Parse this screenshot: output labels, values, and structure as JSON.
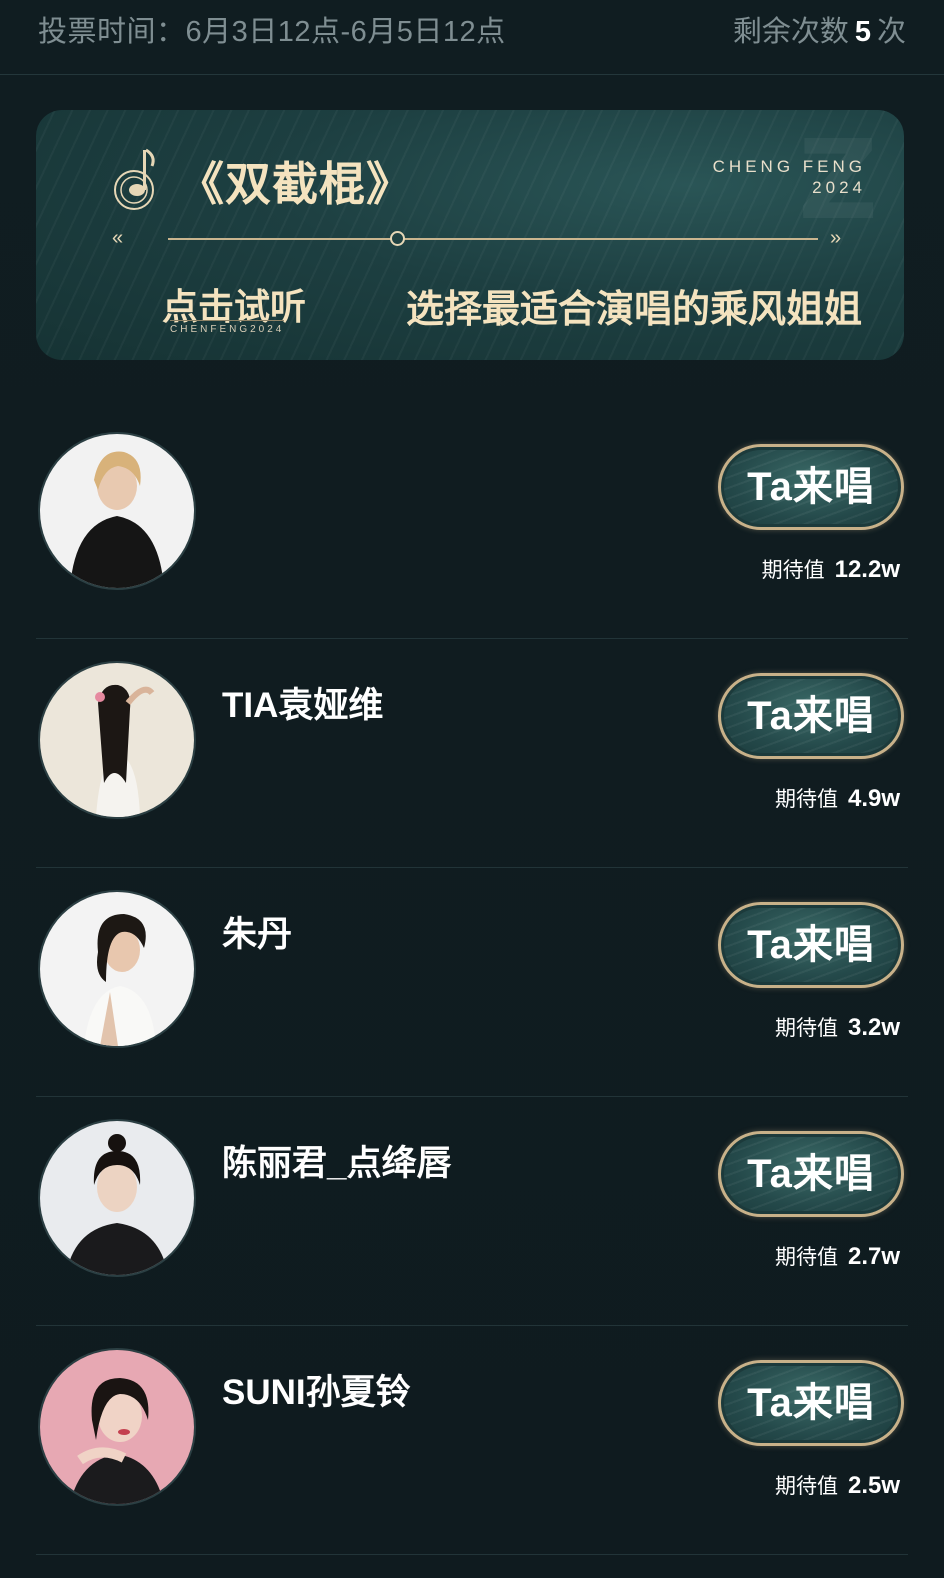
{
  "header": {
    "vote_time": "投票时间：6月3日12点-6月5日12点",
    "remaining_prefix": "剩余次数",
    "remaining_count": "5",
    "remaining_suffix": "次"
  },
  "banner": {
    "song_title": "《双截棍》",
    "brand_line1": "CHENG FENG",
    "brand_line2": "2024",
    "listen_label": "点击试听",
    "listen_sub": "CHENFENG2024",
    "choose_text": "选择最适合演唱的乘风姐姐",
    "prev_icon": "«",
    "next_icon": "»"
  },
  "colors": {
    "background": "#0f1c20",
    "accent_gold": "#c8b189",
    "button_teal": "#24494a",
    "muted_text": "#7f8e92"
  },
  "candidates": [
    {
      "name": "",
      "button_label": "Ta来唱",
      "expect_label": "期待值",
      "expect_value": "12.2w"
    },
    {
      "name": "TIA袁娅维",
      "button_label": "Ta来唱",
      "expect_label": "期待值",
      "expect_value": "4.9w"
    },
    {
      "name": "朱丹",
      "button_label": "Ta来唱",
      "expect_label": "期待值",
      "expect_value": "3.2w"
    },
    {
      "name": "陈丽君_点绛唇",
      "button_label": "Ta来唱",
      "expect_label": "期待值",
      "expect_value": "2.7w"
    },
    {
      "name": "SUNI孙夏铃",
      "button_label": "Ta来唱",
      "expect_label": "期待值",
      "expect_value": "2.5w"
    }
  ]
}
